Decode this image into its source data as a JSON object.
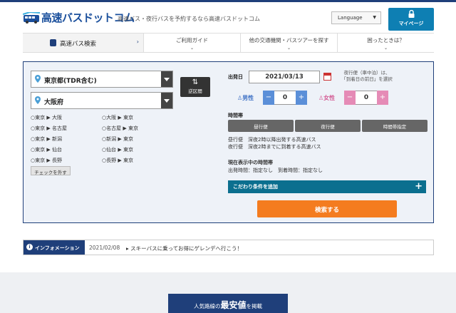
{
  "header": {
    "logo_text": "高速バスドットコム",
    "tagline": "高速バス・夜行バスを予約するなら高速バスドットコム",
    "language_label": "Language",
    "mypage_label": "マイページ"
  },
  "nav": {
    "items": [
      {
        "label": "高速バス検索",
        "icon": "bus-icon"
      },
      {
        "label": "ご利用ガイド"
      },
      {
        "label": "他の交通機関・バスツアーを探す"
      },
      {
        "label": "困ったときは？"
      }
    ]
  },
  "search": {
    "from": "東京都(TDR含む)",
    "to": "大阪府",
    "swap_label": "逆区間",
    "routes_left": [
      "東京 ▶ 大阪",
      "東京 ▶ 名古屋",
      "東京 ▶ 新潟",
      "東京 ▶ 仙台",
      "東京 ▶ 長野"
    ],
    "routes_right": [
      "大阪 ▶ 東京",
      "名古屋 ▶ 東京",
      "新潟 ▶ 東京",
      "仙台 ▶ 東京",
      "長野 ▶ 東京"
    ],
    "uncheck_label": "チェックを外す",
    "date_label": "出発日",
    "date_value": "2021/03/13",
    "date_note_1": "夜行便（車中泊）は、",
    "date_note_2": "「到着日の前日」を選択",
    "male_label": "男性",
    "male_count": "0",
    "female_label": "女性",
    "female_count": "0",
    "timeslot_label": "時間帯",
    "timeslot_buttons": [
      "昼行便",
      "夜行便",
      "時間帯指定"
    ],
    "desc_day": "昼行便　深夜2時以降出発する高速バス",
    "desc_night": "夜行便　深夜2時までに到着する高速バス",
    "current_label": "現在表示中の時間帯",
    "current_value": "出発時間：指定なし　到着時間：指定なし",
    "kodawari_label": "こだわり条件を追加",
    "search_button": "検索する"
  },
  "info": {
    "tag": "インフォメーション",
    "date": "2021/02/08",
    "message": "スキーバスに乗ってお得にゲレンデへ行こう！"
  },
  "banner": {
    "pre": "人気路線の",
    "strong": "最安値",
    "post": "を掲載"
  },
  "colors": {
    "navy": "#1f3f7a",
    "male": "#5b8fd8",
    "female": "#e58bb6",
    "search": "#f47c1f",
    "teal": "#0b6f8f"
  }
}
